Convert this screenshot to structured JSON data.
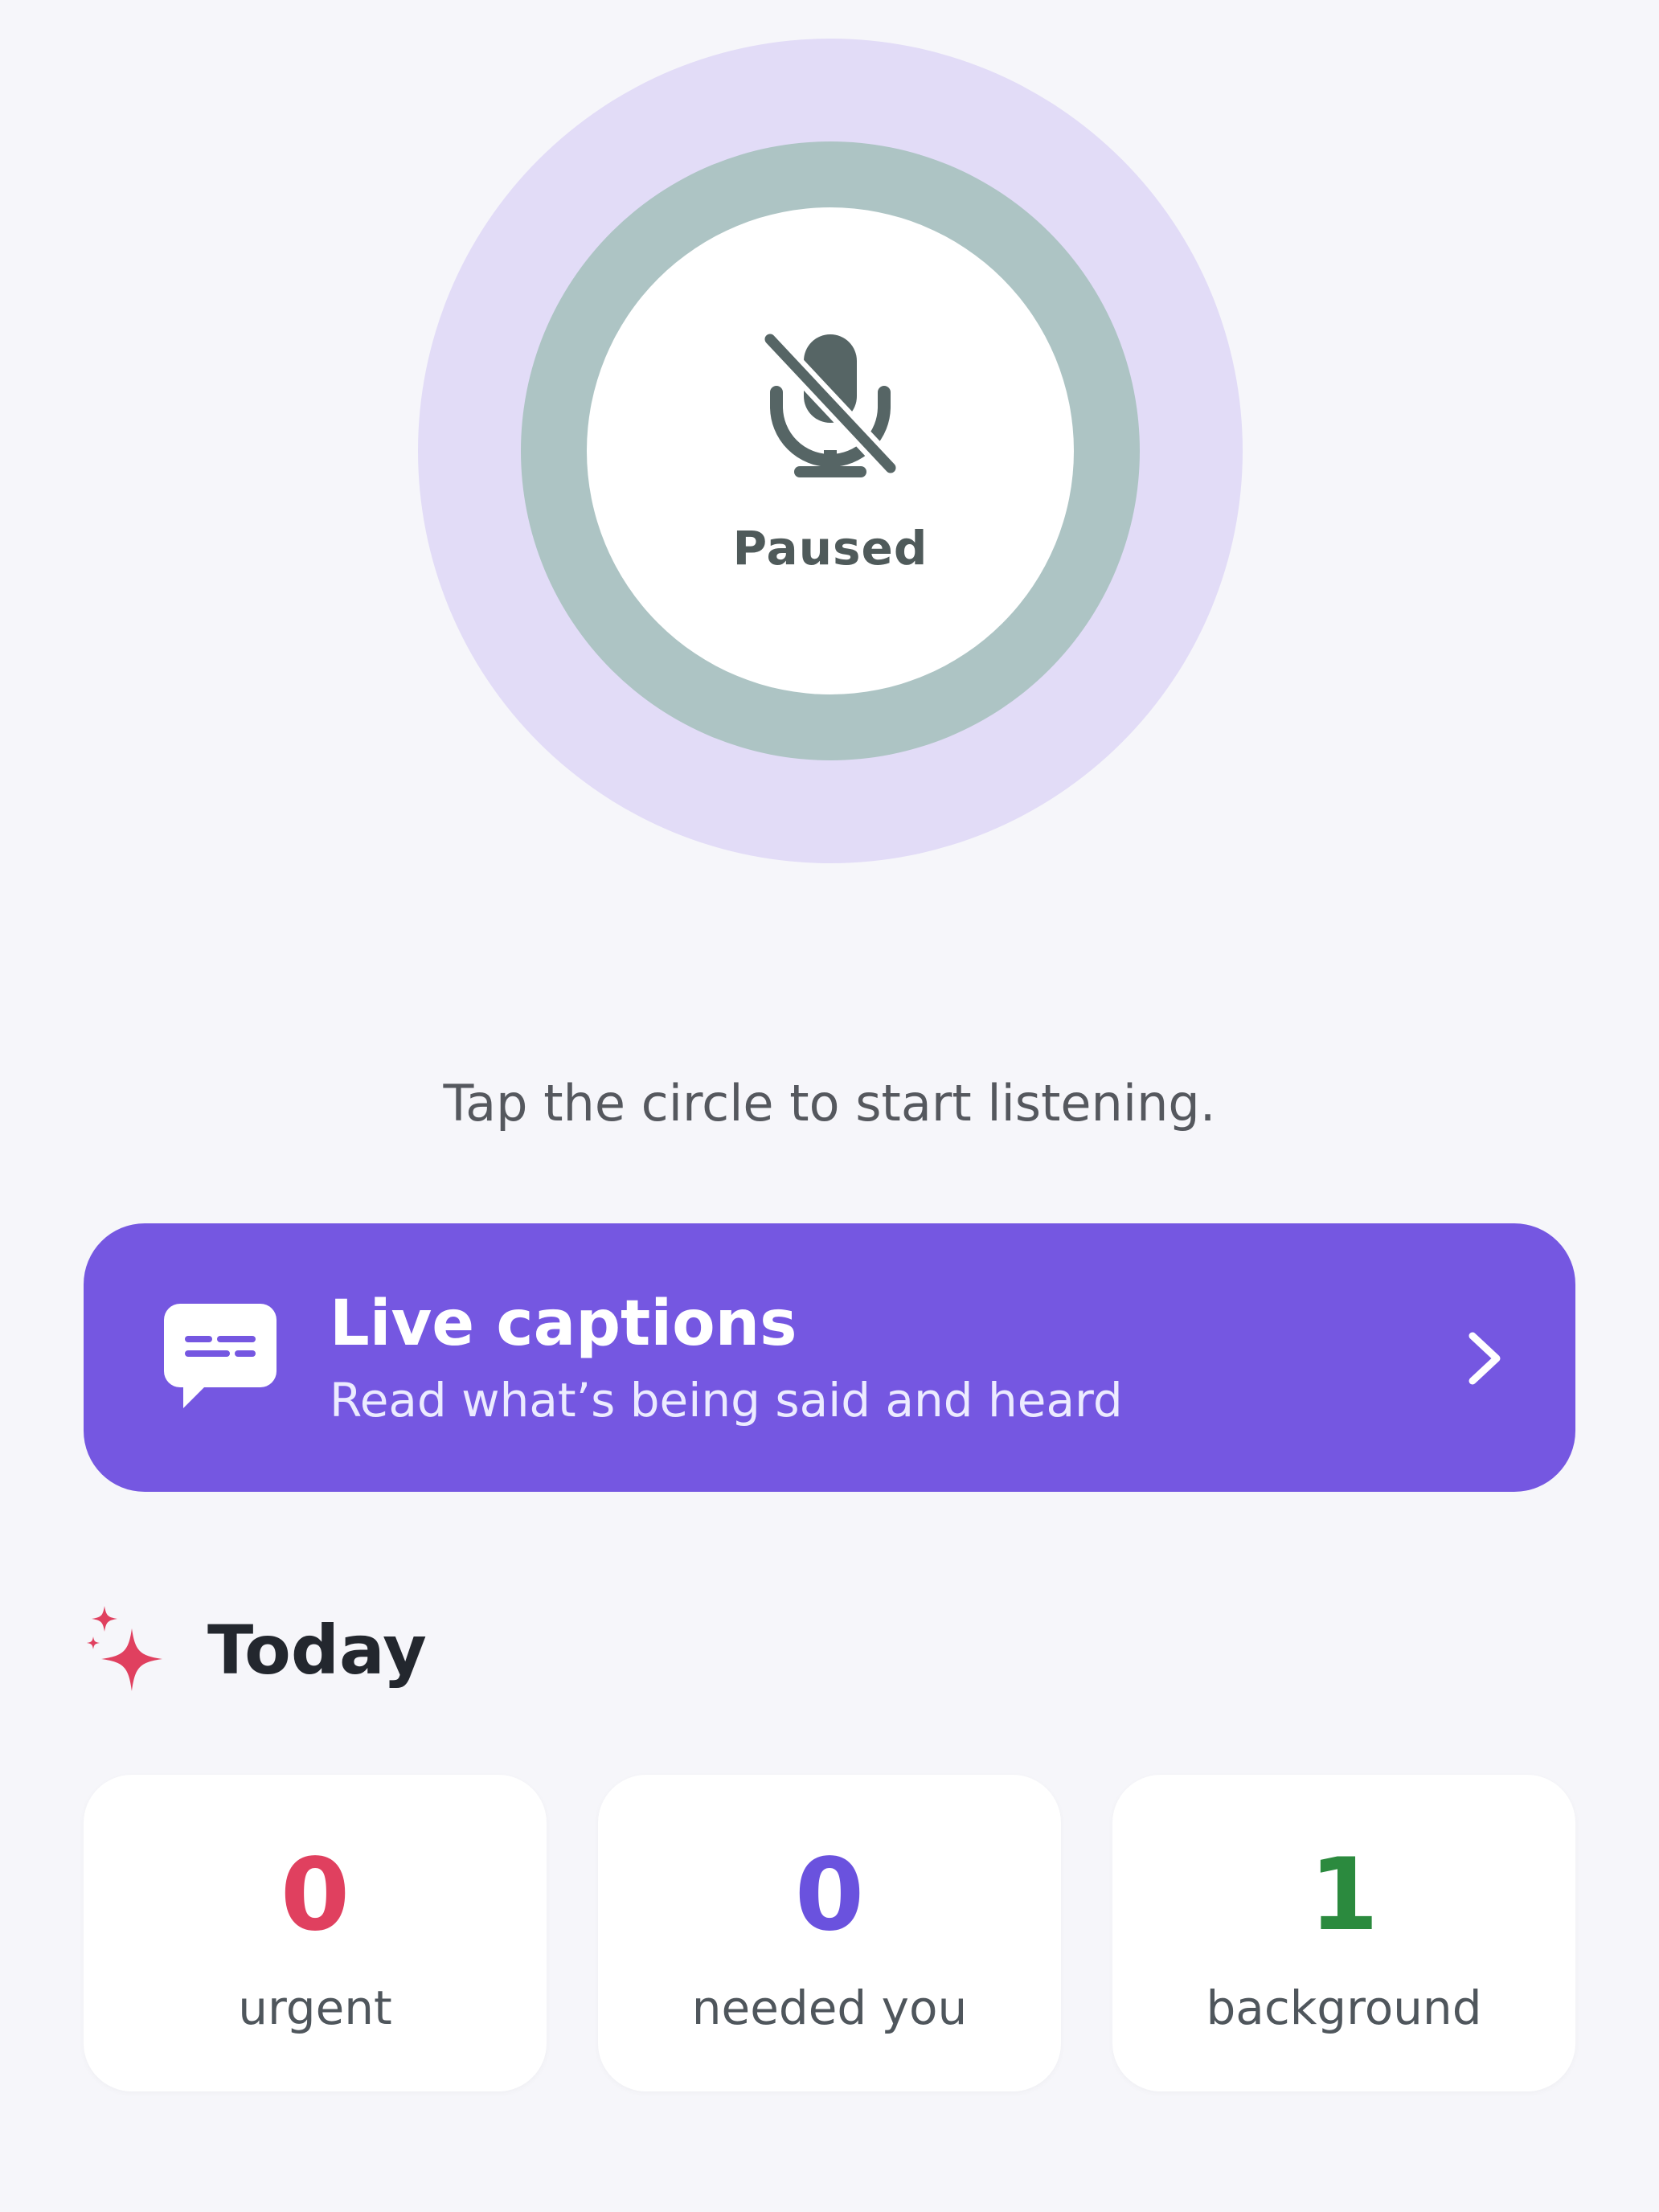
{
  "listen_circle": {
    "status_label": "Paused",
    "icon": "microphone-off-icon"
  },
  "hint_text": "Tap the circle to start listening.",
  "live_captions": {
    "title": "Live captions",
    "subtitle": "Read what’s being said and heard",
    "icon": "caption-bubble-icon",
    "chevron": "chevron-right-icon",
    "color": "#7557e1"
  },
  "today": {
    "title": "Today",
    "icon": "sparkle-icon",
    "stats": [
      {
        "value": "0",
        "label": "urgent",
        "color": "#e0405f"
      },
      {
        "value": "0",
        "label": "needed you",
        "color": "#6a52de"
      },
      {
        "value": "1",
        "label": "background",
        "color": "#2b8a3e"
      }
    ]
  }
}
